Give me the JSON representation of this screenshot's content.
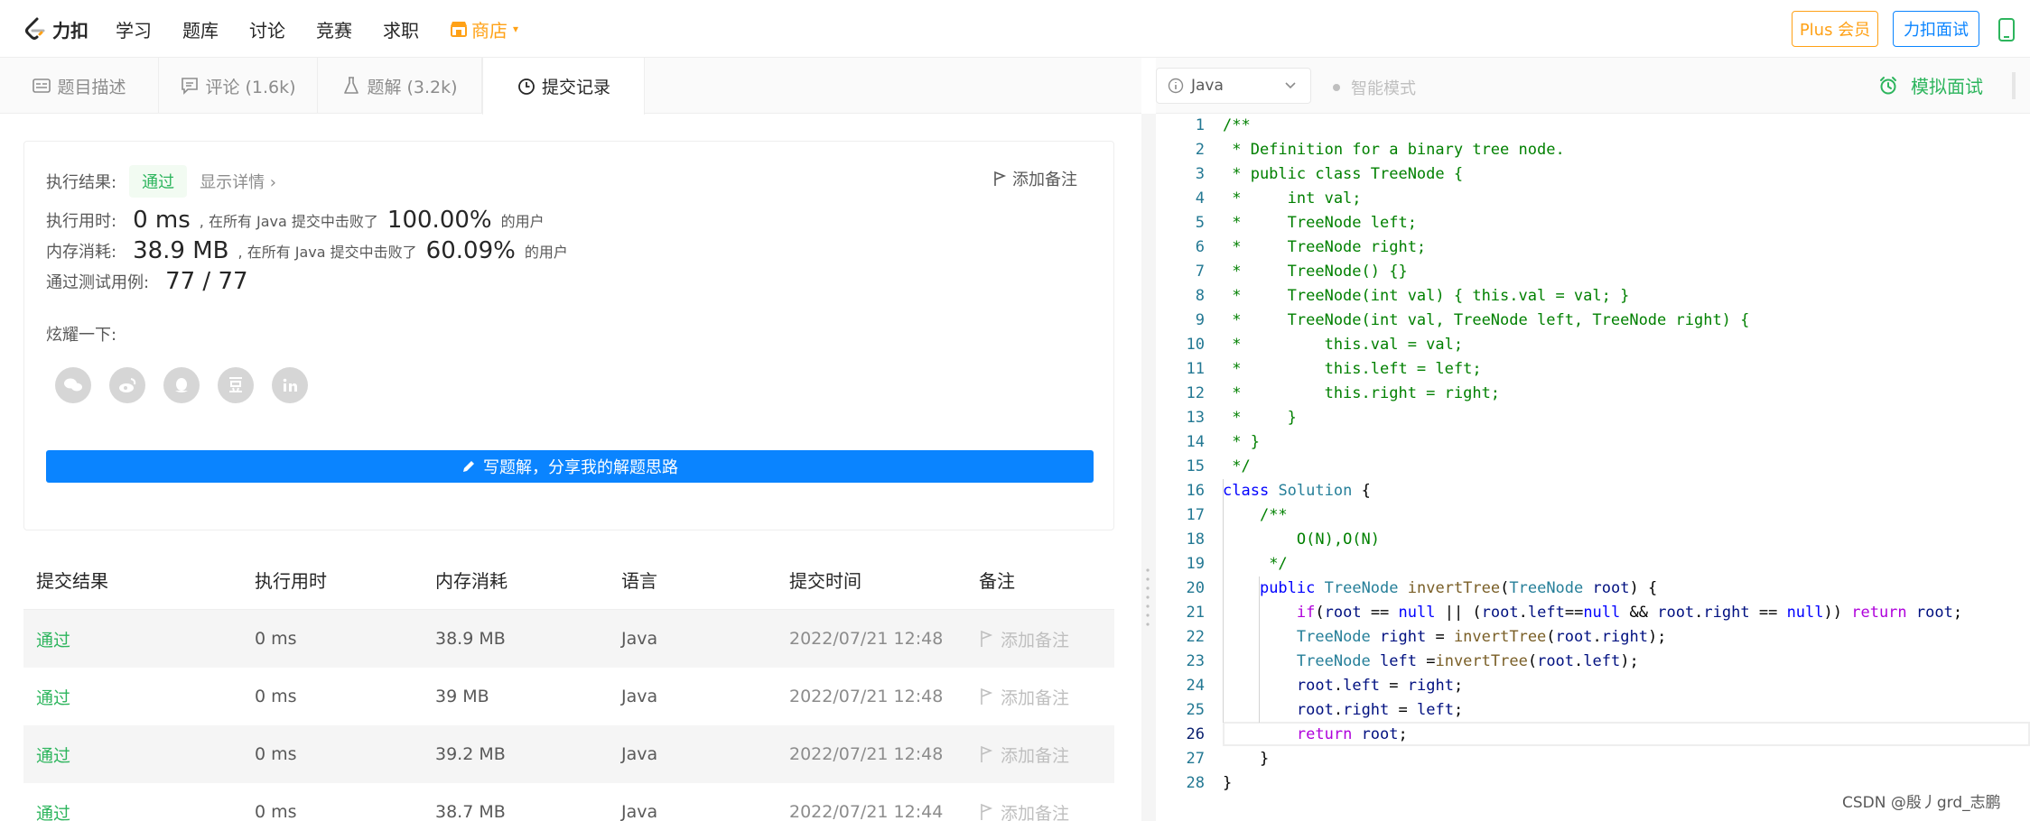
{
  "nav": {
    "logo_text": "力扣",
    "links": [
      "学习",
      "题库",
      "讨论",
      "竞赛",
      "求职"
    ],
    "shop_label": "商店",
    "plus_label": "Plus 会员",
    "mock_label": "力扣面试"
  },
  "tabs": [
    {
      "label": "题目描述",
      "icon": "description-icon"
    },
    {
      "label": "评论 (1.6k)",
      "icon": "comment-icon"
    },
    {
      "label": "题解 (3.2k)",
      "icon": "flask-icon"
    },
    {
      "label": "提交记录",
      "icon": "clock-icon",
      "active": true
    }
  ],
  "result": {
    "status_label": "执行结果:",
    "status_value": "通过",
    "details_link": "显示详情 ›",
    "add_note": "添加备注",
    "runtime_label": "执行用时:",
    "runtime_value": "0 ms",
    "runtime_text": ", 在所有 Java 提交中击败了",
    "runtime_pct": "100.00%",
    "runtime_suffix": "的用户",
    "memory_label": "内存消耗:",
    "memory_value": "38.9 MB",
    "memory_text": ", 在所有 Java 提交中击败了",
    "memory_pct": "60.09%",
    "memory_suffix": "的用户",
    "tests_label": "通过测试用例:",
    "tests_value": "77 / 77",
    "share_label": "炫耀一下:",
    "share_icons": [
      "wechat-icon",
      "weibo-icon",
      "qq-icon",
      "douban-icon",
      "linkedin-icon"
    ],
    "write_button": "写题解，分享我的解题思路"
  },
  "table": {
    "headers": [
      "提交结果",
      "执行用时",
      "内存消耗",
      "语言",
      "提交时间",
      "备注"
    ],
    "rows": [
      {
        "result": "通过",
        "time": "0 ms",
        "memory": "38.9 MB",
        "lang": "Java",
        "submitted": "2022/07/21 12:48",
        "note": "添加备注"
      },
      {
        "result": "通过",
        "time": "0 ms",
        "memory": "39 MB",
        "lang": "Java",
        "submitted": "2022/07/21 12:48",
        "note": "添加备注"
      },
      {
        "result": "通过",
        "time": "0 ms",
        "memory": "39.2 MB",
        "lang": "Java",
        "submitted": "2022/07/21 12:48",
        "note": "添加备注"
      },
      {
        "result": "通过",
        "time": "0 ms",
        "memory": "38.7 MB",
        "lang": "Java",
        "submitted": "2022/07/21 12:44",
        "note": "添加备注"
      }
    ]
  },
  "editor": {
    "language": "Java",
    "smart_mode": "智能模式",
    "mock_interview": "模拟面试",
    "active_line": 26,
    "lines": [
      [
        [
          "cm",
          "/**"
        ]
      ],
      [
        [
          "cm",
          " * Definition for a binary tree node."
        ]
      ],
      [
        [
          "cm",
          " * public class TreeNode {"
        ]
      ],
      [
        [
          "cm",
          " *     int val;"
        ]
      ],
      [
        [
          "cm",
          " *     TreeNode left;"
        ]
      ],
      [
        [
          "cm",
          " *     TreeNode right;"
        ]
      ],
      [
        [
          "cm",
          " *     TreeNode() {}"
        ]
      ],
      [
        [
          "cm",
          " *     TreeNode(int val) { this.val = val; }"
        ]
      ],
      [
        [
          "cm",
          " *     TreeNode(int val, TreeNode left, TreeNode right) {"
        ]
      ],
      [
        [
          "cm",
          " *         this.val = val;"
        ]
      ],
      [
        [
          "cm",
          " *         this.left = left;"
        ]
      ],
      [
        [
          "cm",
          " *         this.right = right;"
        ]
      ],
      [
        [
          "cm",
          " *     }"
        ]
      ],
      [
        [
          "cm",
          " * }"
        ]
      ],
      [
        [
          "cm",
          " */"
        ]
      ],
      [
        [
          "kw",
          "class"
        ],
        [
          "pl",
          " "
        ],
        [
          "ty",
          "Solution"
        ],
        [
          "pl",
          " {"
        ]
      ],
      [
        [
          "pl",
          "    "
        ],
        [
          "cm",
          "/**"
        ]
      ],
      [
        [
          "pl",
          "    "
        ],
        [
          "cm",
          "    O(N),O(N)"
        ]
      ],
      [
        [
          "pl",
          "    "
        ],
        [
          "cm",
          " */"
        ]
      ],
      [
        [
          "pl",
          "    "
        ],
        [
          "kw",
          "public"
        ],
        [
          "pl",
          " "
        ],
        [
          "ty",
          "TreeNode"
        ],
        [
          "pl",
          " "
        ],
        [
          "fn",
          "invertTree"
        ],
        [
          "pl",
          "("
        ],
        [
          "ty",
          "TreeNode"
        ],
        [
          "pl",
          " "
        ],
        [
          "vr",
          "root"
        ],
        [
          "pl",
          ") {"
        ]
      ],
      [
        [
          "pl",
          "        "
        ],
        [
          "ctl",
          "if"
        ],
        [
          "pl",
          "("
        ],
        [
          "vr",
          "root"
        ],
        [
          "pl",
          " == "
        ],
        [
          "kw",
          "null"
        ],
        [
          "pl",
          " || ("
        ],
        [
          "vr",
          "root"
        ],
        [
          "pl",
          "."
        ],
        [
          "vr",
          "left"
        ],
        [
          "pl",
          "=="
        ],
        [
          "kw",
          "null"
        ],
        [
          "pl",
          " && "
        ],
        [
          "vr",
          "root"
        ],
        [
          "pl",
          "."
        ],
        [
          "vr",
          "right"
        ],
        [
          "pl",
          " == "
        ],
        [
          "kw",
          "null"
        ],
        [
          "pl",
          ")) "
        ],
        [
          "ctl",
          "return"
        ],
        [
          "pl",
          " "
        ],
        [
          "vr",
          "root"
        ],
        [
          "pl",
          ";"
        ]
      ],
      [
        [
          "pl",
          "        "
        ],
        [
          "ty",
          "TreeNode"
        ],
        [
          "pl",
          " "
        ],
        [
          "vr",
          "right"
        ],
        [
          "pl",
          " = "
        ],
        [
          "fn",
          "invertTree"
        ],
        [
          "pl",
          "("
        ],
        [
          "vr",
          "root"
        ],
        [
          "pl",
          "."
        ],
        [
          "vr",
          "right"
        ],
        [
          "pl",
          ");"
        ]
      ],
      [
        [
          "pl",
          "        "
        ],
        [
          "ty",
          "TreeNode"
        ],
        [
          "pl",
          " "
        ],
        [
          "vr",
          "left"
        ],
        [
          "pl",
          " ="
        ],
        [
          "fn",
          "invertTree"
        ],
        [
          "pl",
          "("
        ],
        [
          "vr",
          "root"
        ],
        [
          "pl",
          "."
        ],
        [
          "vr",
          "left"
        ],
        [
          "pl",
          ");"
        ]
      ],
      [
        [
          "pl",
          "        "
        ],
        [
          "vr",
          "root"
        ],
        [
          "pl",
          "."
        ],
        [
          "vr",
          "left"
        ],
        [
          "pl",
          " = "
        ],
        [
          "vr",
          "right"
        ],
        [
          "pl",
          ";"
        ]
      ],
      [
        [
          "pl",
          "        "
        ],
        [
          "vr",
          "root"
        ],
        [
          "pl",
          "."
        ],
        [
          "vr",
          "right"
        ],
        [
          "pl",
          " = "
        ],
        [
          "vr",
          "left"
        ],
        [
          "pl",
          ";"
        ]
      ],
      [
        [
          "pl",
          "        "
        ],
        [
          "ctl",
          "return"
        ],
        [
          "pl",
          " "
        ],
        [
          "vr",
          "root"
        ],
        [
          "pl",
          ";"
        ]
      ],
      [
        [
          "pl",
          "    }"
        ]
      ],
      [
        [
          "pl",
          "}"
        ]
      ]
    ]
  },
  "watermark": "CSDN @殷丿grd_志鹏",
  "colors": {
    "brand_orange": "#ffa116",
    "brand_blue": "#0a84ff",
    "pass_green": "#2db55d"
  }
}
